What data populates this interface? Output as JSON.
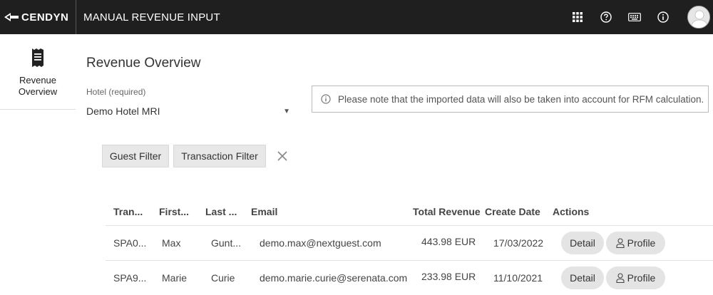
{
  "header": {
    "brand": "CENDYN",
    "app_title": "MANUAL REVENUE INPUT",
    "icons": [
      "apps-grid-icon",
      "help-icon",
      "keyboard-icon",
      "info-icon",
      "user-avatar"
    ]
  },
  "sidebar": {
    "items": [
      {
        "icon": "receipt-icon",
        "label": "Revenue Overview"
      }
    ]
  },
  "main": {
    "title": "Revenue Overview",
    "hotel_field": {
      "label": "Hotel (required)",
      "value": "Demo Hotel MRI"
    },
    "notice": "Please note that the imported data will also be taken into account for RFM calculation.",
    "filters": {
      "guest": "Guest Filter",
      "transaction": "Transaction Filter"
    },
    "table": {
      "columns": [
        "Tran...",
        "First...",
        "Last ...",
        "Email",
        "Total Revenue",
        "Create Date",
        "Actions"
      ],
      "rows": [
        {
          "transaction": "SPA0...",
          "first": "Max",
          "last": "Gunt...",
          "email": "demo.max@nextguest.com",
          "revenue": "443.98 EUR",
          "date": "17/03/2022",
          "detail": "Detail",
          "profile": "Profile"
        },
        {
          "transaction": "SPA9...",
          "first": "Marie",
          "last": "Curie",
          "email": "demo.marie.curie@serenata.com",
          "revenue": "233.98 EUR",
          "date": "11/10/2021",
          "detail": "Detail",
          "profile": "Profile"
        }
      ]
    }
  }
}
